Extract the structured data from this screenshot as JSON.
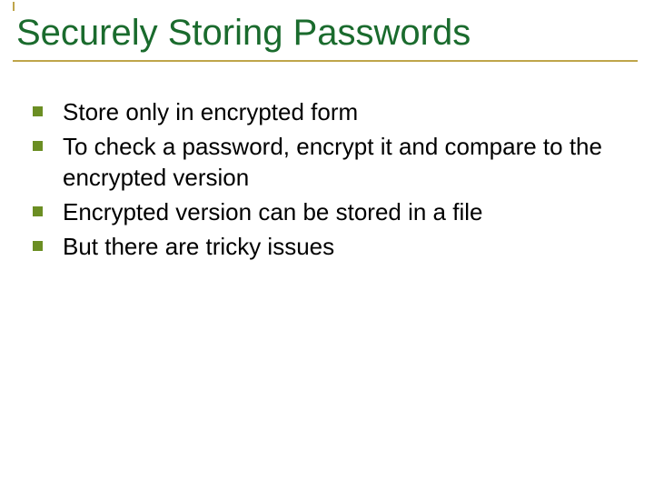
{
  "title": "Securely Storing Passwords",
  "bullets": [
    "Store only in encrypted form",
    "To check a password, encrypt it and compare to the encrypted version",
    "Encrypted version can be stored in a file",
    "But there are tricky issues"
  ]
}
